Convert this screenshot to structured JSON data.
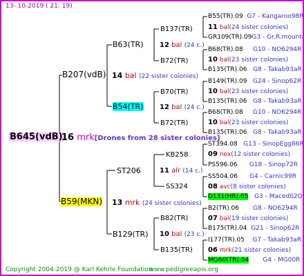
{
  "header": "13- 10-2019 ( 21: 19)",
  "footer_left": "Copyright 2004-2019 @ Karl Kehrle Foundation",
  "footer_right": "www.pedigreeapis.org",
  "root": {
    "label": "B645(vdB)",
    "num": "16",
    "mark": "mrk",
    "note": "[Drones from 28 sister colonies]"
  },
  "sire": {
    "label": "B207(vdB)",
    "num": "14",
    "mark": "bal",
    "note": "(22 sister colonies)",
    "s": {
      "label": "B63(TR)",
      "num": "12",
      "mark": "bal",
      "note": "(24 c.)",
      "s": {
        "label": "B137(TR)",
        "num": "11",
        "mark": "bal",
        "note": "(24 sister colonies)",
        "s": {
          "label": "B55(TR).09",
          "info": "G7 - Kangaroo98R"
        },
        "d": {
          "label": "GR109(TR).09",
          "info": "G3 - Gr.R.mounta"
        }
      },
      "d": {
        "label": "B72(TR)",
        "num": "10",
        "mark": "bal",
        "note": "(23 sister colonies)",
        "s": {
          "label": "B68(TR).08",
          "info": "G10 - NO6294R"
        },
        "d": {
          "label": "B135(TR).06",
          "info": "G8 - Takab93aR"
        }
      }
    },
    "d": {
      "label": "B54(TR)",
      "num": "12",
      "mark": "bal",
      "note": "(24 c.)",
      "s": {
        "label": "B70(TR)",
        "num": "10",
        "mark": "bal",
        "note": "(23 sister colonies)",
        "s": {
          "label": "B149(TR).09",
          "info": "G24 - Sinop62R"
        },
        "d": {
          "label": "B135(TR).06",
          "info": "G8 - Takab93aR"
        }
      },
      "d": {
        "label": "B72(TR)",
        "num": "10",
        "mark": "bal",
        "note": "(23 sister colonies)",
        "s": {
          "label": "B68(TR).08",
          "info": "G10 - NO6294R"
        },
        "d": {
          "label": "B135(TR).06",
          "info": "G8 - Takab93aR"
        }
      }
    }
  },
  "dam": {
    "label": "B59(MKN)",
    "num": "13",
    "mark": "mrk",
    "note": "(24 sister colonies)",
    "s": {
      "label": "ST206",
      "num": "11",
      "mark": "alr",
      "note": "(14 c.)",
      "s": {
        "label": "KB258",
        "num": "09",
        "mark": "nex",
        "note": "(12 sister colonies)",
        "s": {
          "label": "ST394.08",
          "info": "G13 - SinopEgg86R"
        },
        "d": {
          "label": "PS596.06",
          "info": "G18 - Sinop72R"
        }
      },
      "d": {
        "label": "SS324",
        "num": "08",
        "mark": "avc",
        "note": "(8 sister colonies)",
        "s": {
          "label": "SS504.06",
          "info": "G4 - Carnic99R"
        },
        "d": {
          "label": "D131(HR).05",
          "info": "G3 - Maced02Q"
        }
      }
    },
    "d": {
      "label": "B129(TR)",
      "num": "10",
      "mark": "bal",
      "note": "(23 c.)",
      "s": {
        "label": "B82(TR)",
        "num": "07",
        "mark": "bal",
        "note": "(19 sister colonies)",
        "s": {
          "label": "B2(TR).06",
          "info": "G8 - NO6294R"
        },
        "d": {
          "label": "B175(TR).04",
          "info": "G21 - Sinop62R"
        }
      },
      "d": {
        "label": "B135(TR)",
        "num": "06",
        "mark": "mrk",
        "note": "(21 sister colonies)",
        "s": {
          "label": "I177(TR).05",
          "info": "G7 - Takab93aR"
        },
        "d": {
          "label": "MG60(TR).04",
          "info": "G4 - MG00R"
        }
      }
    }
  },
  "colors": {
    "frame": "#cc00cc",
    "lines": "#000000",
    "highlight_root": "#ffccff",
    "highlight_yellow": "#ffff00",
    "highlight_cyan": "#00ffff",
    "highlight_green": "#00ff00"
  }
}
